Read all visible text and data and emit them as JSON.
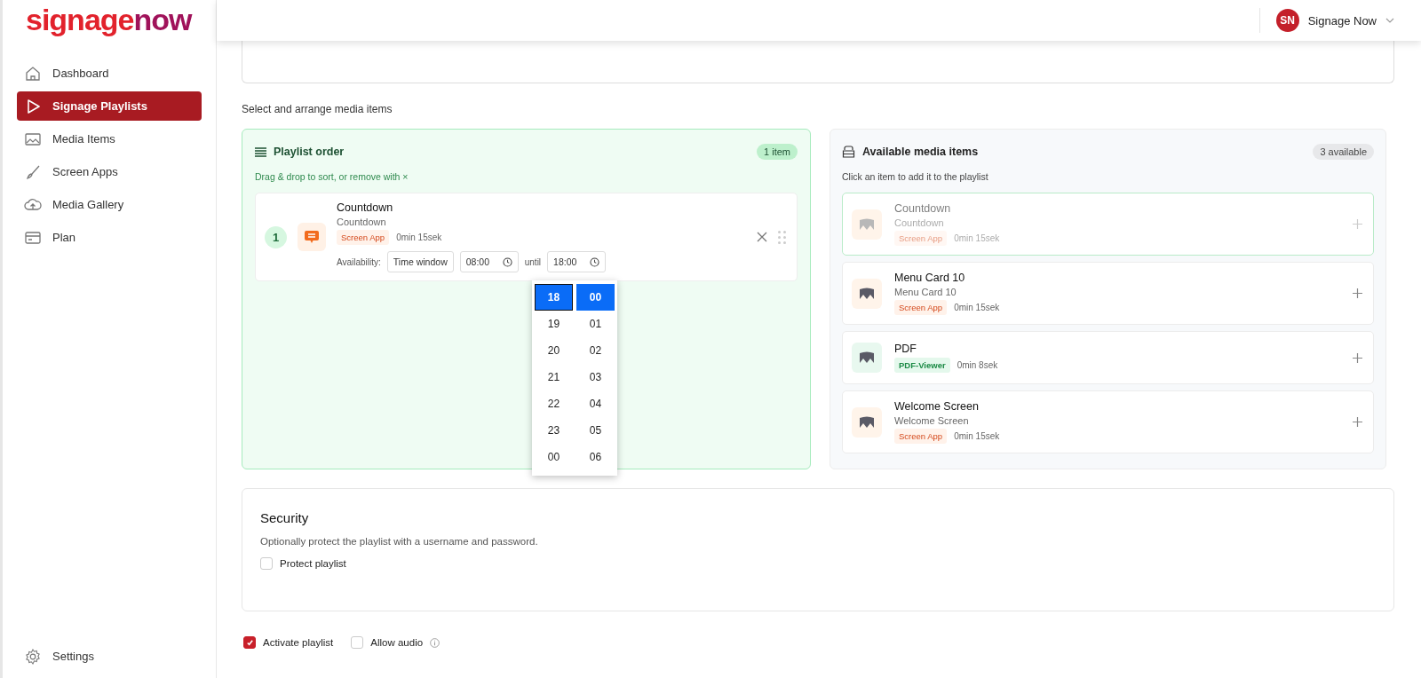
{
  "logo": [
    "signage",
    "now"
  ],
  "sidebar": {
    "items": [
      {
        "label": "Dashboard",
        "selected": false
      },
      {
        "label": "Signage Playlists",
        "selected": true
      },
      {
        "label": "Media Items",
        "selected": false
      },
      {
        "label": "Screen Apps",
        "selected": false
      },
      {
        "label": "Media Gallery",
        "selected": false
      },
      {
        "label": "Plan",
        "selected": false
      }
    ],
    "footer": {
      "label": "Settings"
    }
  },
  "header": {
    "user": {
      "initials": "SN",
      "name": "Signage Now"
    }
  },
  "section_label": "Select and arrange media items",
  "playlist": {
    "title": "Playlist order",
    "count": "1 item",
    "hint": "Drag & drop to sort, or remove with ×",
    "items": [
      {
        "number": "1",
        "title": "Countdown",
        "subtitle": "Countdown",
        "tag": {
          "label": "Screen App",
          "kind": "screen-app"
        },
        "duration": "0min 15sek",
        "availability_label": "Availability:",
        "availability": "Time window",
        "from": "08:00",
        "until_label": "until",
        "to": "18:00"
      }
    ]
  },
  "time_picker": {
    "hours": [
      {
        "label": "18",
        "selected": true
      },
      {
        "label": "19",
        "selected": false
      },
      {
        "label": "20",
        "selected": false
      },
      {
        "label": "21",
        "selected": false
      },
      {
        "label": "22",
        "selected": false
      },
      {
        "label": "23",
        "selected": false
      },
      {
        "label": "00",
        "selected": false
      }
    ],
    "minutes": [
      {
        "label": "00",
        "selected": true
      },
      {
        "label": "01",
        "selected": false
      },
      {
        "label": "02",
        "selected": false
      },
      {
        "label": "03",
        "selected": false
      },
      {
        "label": "04",
        "selected": false
      },
      {
        "label": "05",
        "selected": false
      },
      {
        "label": "06",
        "selected": false
      }
    ]
  },
  "available": {
    "title": "Available media items",
    "count": "3 available",
    "hint": "Click an item to add it to the playlist",
    "items": [
      {
        "title": "Countdown",
        "subtitle": "Countdown",
        "tag": {
          "label": "Screen App",
          "kind": "screen-app"
        },
        "duration": "0min 15sek",
        "added": true
      },
      {
        "title": "Menu Card 10",
        "subtitle": "Menu Card 10",
        "tag": {
          "label": "Screen App",
          "kind": "screen-app"
        },
        "duration": "0min 15sek",
        "added": false
      },
      {
        "title": "PDF",
        "tag": {
          "label": "PDF-Viewer",
          "kind": "pdf-viewer"
        },
        "duration": "0min 8sek",
        "added": false
      },
      {
        "title": "Welcome Screen",
        "subtitle": "Welcome Screen",
        "tag": {
          "label": "Screen App",
          "kind": "screen-app"
        },
        "duration": "0min 15sek",
        "added": false
      }
    ]
  },
  "security": {
    "title": "Security",
    "description": "Optionally protect the playlist with a username and password.",
    "protect": {
      "label": "Protect playlist",
      "checked": false
    }
  },
  "options": [
    {
      "label": "Activate playlist",
      "checked": true,
      "info": false
    },
    {
      "label": "Allow audio",
      "checked": false,
      "info": true
    }
  ]
}
